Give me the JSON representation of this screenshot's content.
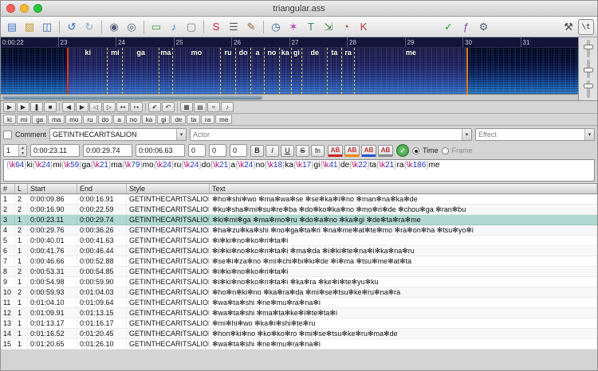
{
  "window": {
    "title": "triangular.ass"
  },
  "toolbar": {
    "items": [
      {
        "name": "new-subtitles-icon",
        "glyph": "▤",
        "color": "#4a7ac8"
      },
      {
        "name": "open-subtitles-icon",
        "glyph": "▨",
        "color": "#c89a33"
      },
      {
        "name": "save-subtitles-icon",
        "glyph": "◫",
        "color": "#3a66b5"
      },
      {
        "sep": true
      },
      {
        "name": "undo-icon",
        "glyph": "↺",
        "color": "#2a6ccc"
      },
      {
        "name": "redo-icon",
        "glyph": "↻",
        "color": "#8fa9c4"
      },
      {
        "sep": true
      },
      {
        "name": "find-icon",
        "glyph": "◉",
        "color": "#55617f"
      },
      {
        "name": "find-replace-icon",
        "glyph": "◎",
        "color": "#55617f"
      },
      {
        "sep": true
      },
      {
        "name": "open-video-icon",
        "glyph": "▭",
        "color": "#3fa03f"
      },
      {
        "name": "open-audio-icon",
        "glyph": "♪",
        "color": "#2a84c8"
      },
      {
        "name": "detach-video-icon",
        "glyph": "▢",
        "color": "#7d7d7d"
      },
      {
        "sep": true
      },
      {
        "name": "styles-manager-icon",
        "glyph": "S",
        "color": "#cc2244"
      },
      {
        "name": "properties-icon",
        "glyph": "☰",
        "color": "#5e5e5e"
      },
      {
        "name": "attachments-icon",
        "glyph": "✎",
        "color": "#97642f"
      },
      {
        "sep": true
      },
      {
        "name": "shift-times-icon",
        "glyph": "◷",
        "color": "#2a66a6"
      },
      {
        "name": "styling-assistant-icon",
        "glyph": "✶",
        "color": "#b04ab0"
      },
      {
        "name": "translation-assistant-icon",
        "glyph": "T",
        "color": "#3a8a5a"
      },
      {
        "name": "resample-icon",
        "glyph": "⇲",
        "color": "#3f8a3f"
      },
      {
        "name": "timing-postprocessor-icon",
        "glyph": "◔",
        "color": "#9a5a2a"
      },
      {
        "name": "kanji-timer-icon",
        "glyph": "K",
        "color": "#b03a3a"
      },
      {
        "spacer": true
      },
      {
        "name": "spellcheck-icon",
        "glyph": "✓",
        "color": "#2fa02f"
      },
      {
        "name": "automation-icon",
        "glyph": "ƒ",
        "color": "#8a44a0"
      },
      {
        "name": "options-icon",
        "glyph": "⚙",
        "color": "#55667a"
      },
      {
        "spacer": true
      },
      {
        "name": "tools-icon",
        "glyph": "⚒",
        "color": "#444444"
      },
      {
        "name": "karaoke-template-icon",
        "glyph": "\\t",
        "color": "#222222",
        "boxed": true
      }
    ]
  },
  "audio": {
    "timeline_labels": [
      "0:00:22",
      "23",
      "24",
      "25",
      "26",
      "27",
      "28",
      "29",
      "30",
      "31"
    ],
    "selection": {
      "left_pct": 11.5,
      "width_pct": 69.5
    },
    "syllables": [
      {
        "k": 64,
        "s": "ki"
      },
      {
        "k": 24,
        "s": "mi"
      },
      {
        "k": 59,
        "s": "ga"
      },
      {
        "k": 21,
        "s": "ma"
      },
      {
        "k": 79,
        "s": "mo"
      },
      {
        "k": 24,
        "s": "ru"
      },
      {
        "k": 24,
        "s": "do"
      },
      {
        "k": 21,
        "s": "a"
      },
      {
        "k": 24,
        "s": "no"
      },
      {
        "k": 18,
        "s": "ka"
      },
      {
        "k": 17,
        "s": "gi"
      },
      {
        "k": 41,
        "s": "de"
      },
      {
        "k": 22,
        "s": "ta"
      },
      {
        "k": 21,
        "s": "ra"
      },
      {
        "k": 186,
        "s": "me"
      }
    ]
  },
  "playbar": {
    "buttons": [
      {
        "name": "play-button",
        "glyph": "▶"
      },
      {
        "name": "play-selection-button",
        "glyph": "▶"
      },
      {
        "name": "pause-button",
        "glyph": "❚"
      },
      {
        "name": "stop-button",
        "glyph": "■"
      },
      {
        "sep": true
      },
      {
        "name": "play-before-button",
        "glyph": "◀"
      },
      {
        "name": "play-after-button",
        "glyph": "▶"
      },
      {
        "name": "play-first-500ms-button",
        "glyph": "◁"
      },
      {
        "name": "play-last-500ms-button",
        "glyph": "▷"
      },
      {
        "name": "goto-selection-start-button",
        "glyph": "↤"
      },
      {
        "name": "goto-selection-end-button",
        "glyph": "↦"
      },
      {
        "sep": true
      },
      {
        "name": "commit-changes-button",
        "glyph": "✔"
      },
      {
        "name": "revert-changes-button",
        "glyph": "↶"
      },
      {
        "sep": true
      },
      {
        "name": "spectrum-mode-button",
        "glyph": "▦"
      },
      {
        "name": "waveform-mode-button",
        "glyph": "▤"
      },
      {
        "name": "vertical-link-button",
        "glyph": "≈"
      },
      {
        "name": "karaoke-mode-button",
        "glyph": "♪"
      }
    ]
  },
  "karaoke_bar": {
    "syllables": [
      "ki",
      "mi",
      "ga",
      "ma",
      "mo",
      "ru",
      "do",
      "a",
      "no",
      "ka",
      "gi",
      "de",
      "ta",
      "ra",
      "me"
    ]
  },
  "edit": {
    "comment_label": "Comment",
    "style_value": "GETINTHECARITSALION",
    "actor_value": "Actor",
    "effect_value": "Effect",
    "layer_value": "1",
    "start_time": "0:00:23.11",
    "end_time": "0:00:29.74",
    "duration": "0:00:06.63",
    "margin_l": "0",
    "margin_r": "0",
    "margin_v": "0",
    "format_buttons": [
      {
        "name": "bold-button",
        "label": "B"
      },
      {
        "name": "italic-button",
        "label": "I"
      },
      {
        "name": "underline-button",
        "label": "U"
      },
      {
        "name": "strikeout-button",
        "label": "S"
      },
      {
        "name": "font-button",
        "label": "fn"
      }
    ],
    "color_buttons": [
      {
        "name": "primary-color-button",
        "label": "AB",
        "color": "#cc2222"
      },
      {
        "name": "secondary-color-button",
        "label": "AB",
        "color": "#ee8800"
      },
      {
        "name": "outline-color-button",
        "label": "AB",
        "color": "#2255cc"
      },
      {
        "name": "shadow-color-button",
        "label": "AB",
        "color": "#888888"
      }
    ],
    "time_label": "Time",
    "frame_label": "Frame",
    "karaoke_segments": [
      {
        "k": "64",
        "s": "ki"
      },
      {
        "k": "24",
        "s": "mi"
      },
      {
        "k": "59",
        "s": "ga"
      },
      {
        "k": "21",
        "s": "ma"
      },
      {
        "k": "79",
        "s": "mo"
      },
      {
        "k": "24",
        "s": "ru"
      },
      {
        "k": "24",
        "s": "do"
      },
      {
        "k": "21",
        "s": "a"
      },
      {
        "k": "24",
        "s": "no"
      },
      {
        "k": "18",
        "s": "ka"
      },
      {
        "k": "17",
        "s": "gi"
      },
      {
        "k": "41",
        "s": "de"
      },
      {
        "k": "22",
        "s": "ta"
      },
      {
        "k": "21",
        "s": "ra"
      },
      {
        "k": "186",
        "s": "me"
      }
    ]
  },
  "grid": {
    "headers": [
      "#",
      "L",
      "Start",
      "End",
      "Style",
      "Text"
    ],
    "selected_row": 3,
    "rows": [
      {
        "n": "1",
        "l": "2",
        "start": "0:00:09.86",
        "end": "0:00:16.91",
        "style": "GETINTHECARITSALION",
        "text": "✻ho✻shi✻wo ✻ma✻wa✻se ✻se✻ka✻i✻no ✻man✻na✻ka✻de"
      },
      {
        "n": "2",
        "l": "2",
        "start": "0:00:16.90",
        "end": "0:00:22.59",
        "style": "GETINTHECARITSALION",
        "text": "✻ku✻sha✻mi✻su✻re✻ba ✻do✻ko✻ka✻no ✻mo✻ri✻de ✻chou✻ga ✻ran✻bu"
      },
      {
        "n": "3",
        "l": "1",
        "start": "0:00:23.11",
        "end": "0:00:29.74",
        "style": "GETINTHECARITSALION",
        "text": "✻ki✻mi✻ga ✻ma✻mo✻ru ✻do✻a✻no ✻ka✻gi ✻de✻ta✻ra✻me"
      },
      {
        "n": "4",
        "l": "2",
        "start": "0:00:29.76",
        "end": "0:00:36.26",
        "style": "GETINTHECARITSALION",
        "text": "✻ha✻zu✻ka✻shi ✻no✻ga✻ta✻ri ✻na✻me✻at✻te✻mo ✻ra✻on✻ha ✻tsu✻yo✻i"
      },
      {
        "n": "5",
        "l": "1",
        "start": "0:00:40.01",
        "end": "0:00:41.63",
        "style": "GETINTHECARITSALION",
        "text": "✻i✻ki✻no✻ko✻ri✻ta✻i"
      },
      {
        "n": "6",
        "l": "1",
        "start": "0:00:41.76",
        "end": "0:00:46.44",
        "style": "GETINTHECARITSALION",
        "text": "✻i✻ki✻no✻ko✻ri✻ta✻i ✻ma✻da ✻i✻ki✻te✻na✻i✻ka✻na✻ru"
      },
      {
        "n": "7",
        "l": "1",
        "start": "0:00:46.66",
        "end": "0:00:52.88",
        "style": "GETINTHECARITSALION",
        "text": "✻se✻i✻za✻no ✻mi✻chi✻bi✻ki✻de ✻i✻ma ✻tsu✻me✻at✻ta"
      },
      {
        "n": "8",
        "l": "2",
        "start": "0:00:53.31",
        "end": "0:00:54.85",
        "style": "GETINTHECARITSALION",
        "text": "✻i✻ki✻no✻ko✻ri✻ta✻i"
      },
      {
        "n": "9",
        "l": "1",
        "start": "0:00:54.98",
        "end": "0:00:59.90",
        "style": "GETINTHECARITSALION",
        "text": "✻i✻ki✻no✻ko✻ri✻ta✻i ✻ka✻ra ✻ke✻i✻te✻yu✻ku"
      },
      {
        "n": "10",
        "l": "2",
        "start": "0:00:59.93",
        "end": "0:01:04.03",
        "style": "GETINTHECARITSALION",
        "text": "✻ho✻n✻ki✻no ✻ka✻ra✻da ✻mi✻se✻tsu✻ke✻ru✻na✻ra"
      },
      {
        "n": "11",
        "l": "1",
        "start": "0:01:04.10",
        "end": "0:01:09.64",
        "style": "GETINTHECARITSALION",
        "text": "✻wa✻ta✻shi ✻ne✻mu✻ra✻na✻i"
      },
      {
        "n": "12",
        "l": "1",
        "start": "0:01:09.91",
        "end": "0:01:13.15",
        "style": "GETINTHECARITSALION",
        "text": "✻wa✻ta✻shi ✻ma✻ta✻ke✻i✻te✻ta✻i"
      },
      {
        "n": "13",
        "l": "1",
        "start": "0:01:13.17",
        "end": "0:01:16.17",
        "style": "GETINTHECARITSALION",
        "text": "✻mi✻hi✻wo ✻ka✻i✻shi✻te✻ru"
      },
      {
        "n": "14",
        "l": "1",
        "start": "0:01:16.52",
        "end": "0:01:20.45",
        "style": "GETINTHECARITSALION",
        "text": "✻hon✻ki✻no ✻ko✻ko✻ro ✻mi✻se✻tsu✻ke✻ru✻ma✻de"
      },
      {
        "n": "15",
        "l": "1",
        "start": "0:01:20.65",
        "end": "0:01:26.10",
        "style": "GETINTHECARITSALION",
        "text": "✻wa✻ta✻shi ✻ne✻mu✻ra✻na✻i"
      }
    ]
  }
}
